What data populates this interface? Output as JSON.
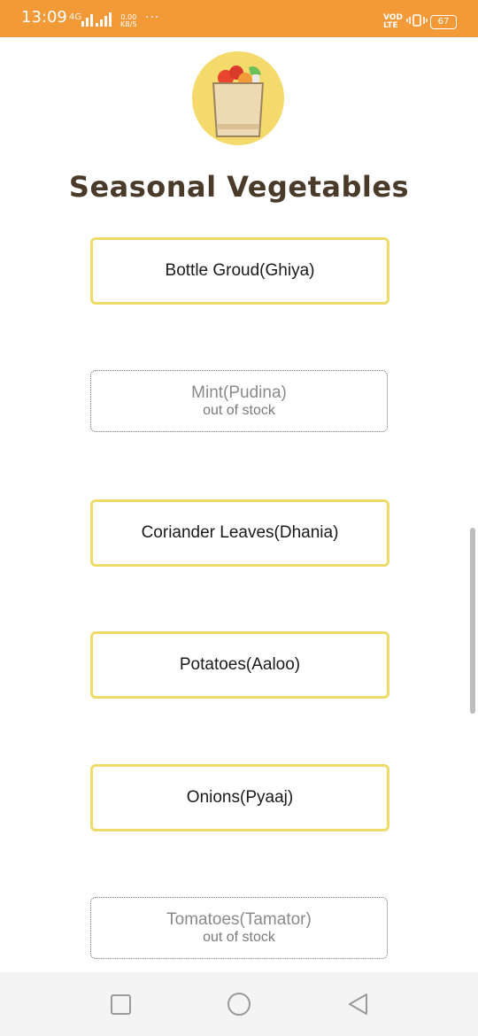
{
  "status_bar": {
    "time": "13:09",
    "network": "4G",
    "speed_value": "0.00",
    "speed_unit": "KB/S",
    "more": "···",
    "volte_top": "VOD",
    "volte_bottom": "LTE",
    "battery": "67",
    "color": "#F29A38"
  },
  "header": {
    "logo_icon": "grocery-bag-icon",
    "title": "Seasonal Vegetables"
  },
  "items": [
    {
      "label": "Bottle Groud(Ghiya)",
      "available": true
    },
    {
      "label": "Mint(Pudina)",
      "available": false,
      "note": "out of stock"
    },
    {
      "label": "Coriander Leaves(Dhania)",
      "available": true
    },
    {
      "label": "Potatoes(Aaloo)",
      "available": true
    },
    {
      "label": "Onions(Pyaaj)",
      "available": true
    },
    {
      "label": "Tomatoes(Tamator)",
      "available": false,
      "note": "out of stock"
    }
  ],
  "nav_bar": {
    "recent_icon": "square-icon",
    "home_icon": "circle-icon",
    "back_icon": "triangle-back-icon"
  },
  "colors": {
    "accent_border": "#EDDB6A",
    "title": "#4A3A2A",
    "logo_bg": "#F4DA6A"
  }
}
